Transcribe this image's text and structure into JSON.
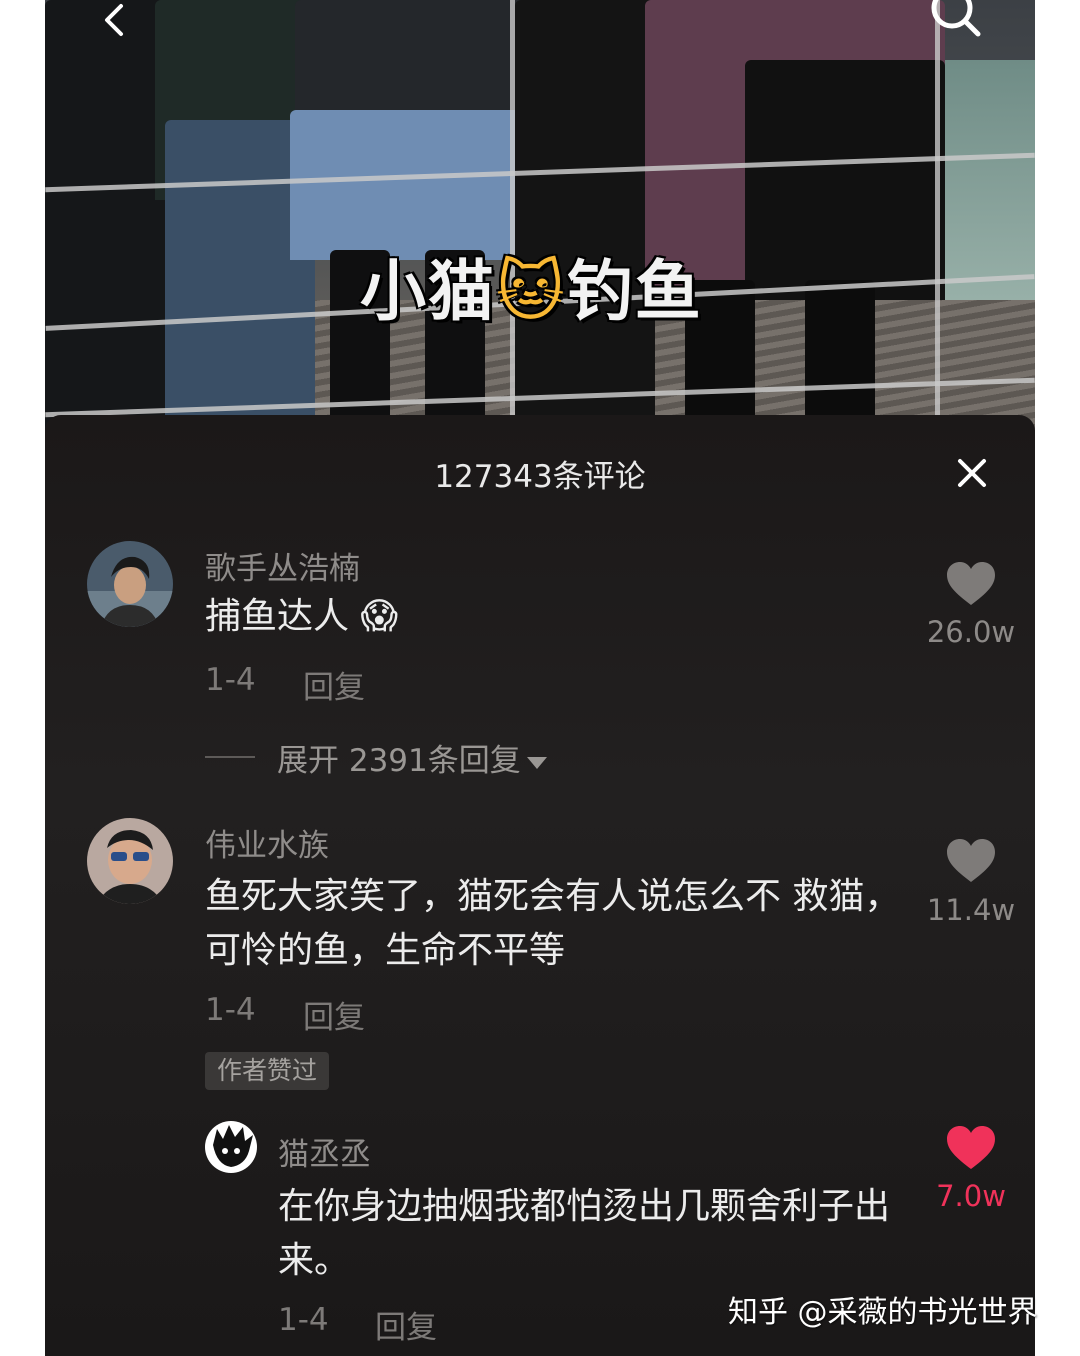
{
  "video": {
    "caption_left": "小猫",
    "caption_emoji": "🐱",
    "caption_right": "钓鱼"
  },
  "comments_panel": {
    "title": "127343条评论",
    "comments": [
      {
        "username": "歌手丛浩楠",
        "text": "捕鱼达人 😱",
        "date": "1-4",
        "reply_label": "回复",
        "likes": "26.0w",
        "expand_label": "展开 2391条回复"
      },
      {
        "username": "伟业水族",
        "text": "鱼死大家笑了，猫死会有人说怎么不 救猫，可怜的鱼，生命不平等",
        "date": "1-4",
        "reply_label": "回复",
        "likes": "11.4w",
        "badge": "作者赞过"
      },
      {
        "username": "猫丞丞",
        "text": "在你身边抽烟我都怕烫出几颗舍利子出来。",
        "date": "1-4",
        "reply_label": "回复",
        "likes": "7.0w",
        "liked": true
      }
    ]
  },
  "watermark": "知乎 @采薇的书光世界",
  "colors": {
    "panel_bg": "#1b1818",
    "liked_red": "#f0325a",
    "muted_text": "#8f8c8a"
  }
}
